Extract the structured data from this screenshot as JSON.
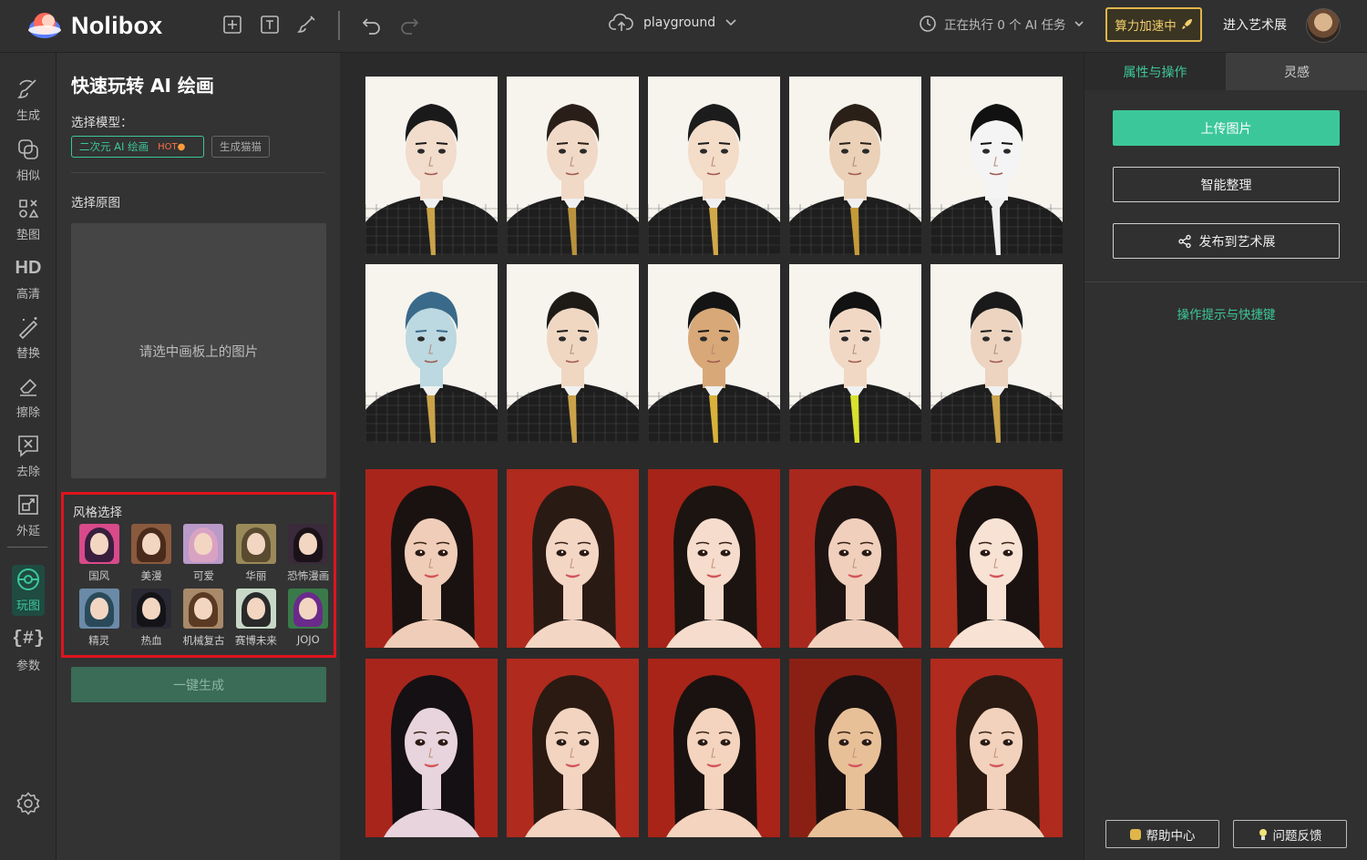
{
  "app": {
    "name": "Nolibox",
    "project": "playground",
    "task_status": "正在执行 0 个 AI 任务",
    "boost_label": "算力加速中",
    "gallery_link": "进入艺术展"
  },
  "left_nav": [
    {
      "label": "生成",
      "icon": "brush-icon"
    },
    {
      "label": "相似",
      "icon": "copy-icon"
    },
    {
      "label": "垫图",
      "icon": "shapes-icon"
    },
    {
      "label": "高清",
      "icon": "hd-icon",
      "glyph": "HD"
    },
    {
      "label": "替换",
      "icon": "magic-wand-icon"
    },
    {
      "label": "擦除",
      "icon": "eraser-icon"
    },
    {
      "label": "去除",
      "icon": "remove-icon"
    },
    {
      "label": "外延",
      "icon": "expand-icon"
    },
    {
      "label": "玩图",
      "icon": "play-icon",
      "active": true
    },
    {
      "label": "参数",
      "icon": "params-icon",
      "glyph": "{#}"
    }
  ],
  "panel": {
    "title": "快速玩转 AI 绘画",
    "model_label": "选择模型：",
    "model_selected": "二次元 AI 绘画",
    "model_badge": "HOT",
    "model_other": "生成猫猫",
    "source_label": "选择原图",
    "source_placeholder": "请选中画板上的图片",
    "style_title": "风格选择",
    "styles": [
      {
        "label": "国风",
        "bg": "#d94a8a",
        "hair": "#3a1e3e"
      },
      {
        "label": "美漫",
        "bg": "#8a5a3e",
        "hair": "#4a2a1a"
      },
      {
        "label": "可爱",
        "bg": "#b99ac8",
        "hair": "#d9a2c2"
      },
      {
        "label": "华丽",
        "bg": "#9a8a5a",
        "hair": "#5a4a30"
      },
      {
        "label": "恐怖漫画",
        "bg": "#3a2a3a",
        "hair": "#1a1218"
      },
      {
        "label": "精灵",
        "bg": "#6a8aa8",
        "hair": "#2a4a5a"
      },
      {
        "label": "热血",
        "bg": "#2a2a34",
        "hair": "#141418"
      },
      {
        "label": "机械复古",
        "bg": "#a88a6a",
        "hair": "#5a3a22"
      },
      {
        "label": "赛博未来",
        "bg": "#c8d8c8",
        "hair": "#2a2a2a"
      },
      {
        "label": "JOJO",
        "bg": "#3a7a4a",
        "hair": "#6a2a8a"
      }
    ],
    "generate_label": "一键生成"
  },
  "right_panel": {
    "tab_active": "属性与操作",
    "tab_inactive": "灵感",
    "upload_label": "上传图片",
    "organize_label": "智能整理",
    "publish_label": "发布到艺术展",
    "hint_label": "操作提示与快捷键",
    "help_label": "帮助中心",
    "feedback_label": "问题反馈"
  },
  "colors": {
    "accent": "#3cc79a",
    "highlight_border": "#e0141e",
    "boost": "#e0b54a"
  },
  "canvas_images": [
    {
      "group": "male",
      "skin": "#f2dccb",
      "hair": "#1a1a1a",
      "tie": "#c9a24a"
    },
    {
      "group": "male",
      "skin": "#f0d9c6",
      "hair": "#2a1f18",
      "tie": "#b8923e"
    },
    {
      "group": "male",
      "skin": "#f3dcc8",
      "hair": "#1c1c1c",
      "tie": "#d1a848"
    },
    {
      "group": "male",
      "skin": "#ead1b8",
      "hair": "#2a2018",
      "tie": "#c49a3a"
    },
    {
      "group": "male",
      "skin": "#f4f4f4",
      "hair": "#111111",
      "tie": "#eeeeee"
    },
    {
      "group": "male",
      "skin": "#bcd8e0",
      "hair": "#3a6a8a",
      "tie": "#c9a24a"
    },
    {
      "group": "male",
      "skin": "#efd7c2",
      "hair": "#1e1a16",
      "tie": "#c9a24a"
    },
    {
      "group": "male",
      "skin": "#d8a878",
      "hair": "#141414",
      "tie": "#d9b03a"
    },
    {
      "group": "male",
      "skin": "#f1d8c4",
      "hair": "#121212",
      "tie": "#d8e030"
    },
    {
      "group": "male",
      "skin": "#ecd4c0",
      "hair": "#1a1a1a",
      "tie": "#c9a24a"
    },
    {
      "group": "female",
      "skin": "#f0cdb8",
      "hair": "#1a1210",
      "bg": "#a8251c"
    },
    {
      "group": "female",
      "skin": "#f4d6c4",
      "hair": "#2a1a14",
      "bg": "#b02a1e"
    },
    {
      "group": "female",
      "skin": "#f6dccc",
      "hair": "#1c1410",
      "bg": "#a52318"
    },
    {
      "group": "female",
      "skin": "#f0d0bc",
      "hair": "#1e1412",
      "bg": "#a8281e"
    },
    {
      "group": "female",
      "skin": "#f8e2d4",
      "hair": "#1a1210",
      "bg": "#b2301e"
    },
    {
      "group": "female",
      "skin": "#e8d4dc",
      "hair": "#141014",
      "bg": "#a8251c"
    },
    {
      "group": "female",
      "skin": "#f2d4c0",
      "hair": "#2a1a12",
      "bg": "#b02a1e"
    },
    {
      "group": "female",
      "skin": "#f4d4be",
      "hair": "#1a1210",
      "bg": "#a82418"
    },
    {
      "group": "female",
      "skin": "#e8c098",
      "hair": "#1a1210",
      "bg": "#8a2014"
    },
    {
      "group": "female",
      "skin": "#f2d2bc",
      "hair": "#2a1a12",
      "bg": "#b02a1e"
    }
  ]
}
